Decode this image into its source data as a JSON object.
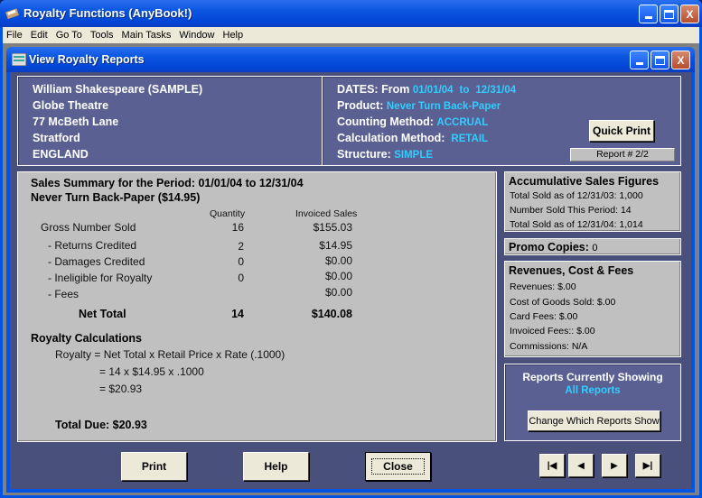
{
  "app": {
    "title": "Royalty Functions (AnyBook!)",
    "controls": {
      "minimize": "_",
      "maximize": "□",
      "close": "X"
    }
  },
  "menu": [
    "File",
    "Edit",
    "Go To",
    "Tools",
    "Main Tasks",
    "Window",
    "Help"
  ],
  "window": {
    "title": "View Royalty Reports"
  },
  "author": {
    "lines": [
      "William Shakespeare (SAMPLE)",
      "Globe Theatre",
      "77 McBeth Lane",
      "Stratford",
      "ENGLAND"
    ]
  },
  "info": {
    "dates_label": "DATES:  From",
    "date_from": "01/01/04",
    "to_label": "to",
    "date_to": "12/31/04",
    "product_label": "Product:",
    "product": "Never Turn Back-Paper",
    "counting_label": "Counting Method:",
    "counting": "ACCRUAL",
    "calc_label": "Calculation Method:",
    "calc": "RETAIL",
    "structure_label": "Structure:",
    "structure": "SIMPLE",
    "quick_print": "Quick Print",
    "report_num": "Report # 2/2"
  },
  "summary": {
    "title": "Sales Summary for the Period:  01/01/04 to 12/31/04",
    "product": "Never Turn Back-Paper ($14.95)",
    "col_qty": "Quantity",
    "col_sales": "Invoiced Sales",
    "rows": [
      {
        "label": "Gross Number Sold",
        "qty": "16",
        "sales": "$155.03"
      },
      {
        "label": "- Returns Credited",
        "qty": "2",
        "sales": "$14.95"
      },
      {
        "label": "- Damages Credited",
        "qty": "0",
        "sales": "$0.00"
      },
      {
        "label": "- Ineligible for Royalty",
        "qty": "0",
        "sales": "$0.00"
      },
      {
        "label": "- Fees",
        "qty": "",
        "sales": "$0.00"
      }
    ],
    "net": {
      "label": "Net Total",
      "qty": "14",
      "sales": "$140.08"
    },
    "royalty_title": "Royalty Calculations",
    "formula1": "Royalty  =  Net Total  x  Retail Price  x  Rate (.1000)",
    "formula2": "=  14 x $14.95 x .1000",
    "formula3": "=  $20.93",
    "total_due": "Total Due: $20.93"
  },
  "accum": {
    "title": "Accumulative Sales Figures",
    "items": [
      "Total Sold as of 12/31/03: 1,000",
      "Number Sold This Period: 14",
      "Total Sold as of 12/31/04: 1,014"
    ]
  },
  "promo": {
    "label": "Promo Copies:",
    "value": "0"
  },
  "revenues": {
    "title": "Revenues, Cost & Fees",
    "items": [
      "Revenues: $.00",
      "Cost of Goods Sold: $.00",
      "Card Fees: $.00",
      "Invoiced Fees:: $.00",
      "Commissions: N/A"
    ]
  },
  "reports": {
    "title": "Reports Currently Showing",
    "value": "All Reports",
    "button": "Change Which Reports Show"
  },
  "buttons": {
    "print": "Print",
    "help": "Help",
    "close": "Close"
  },
  "nav": {
    "first": "⏮",
    "prev": "◀",
    "next": "▶",
    "last": "⏭"
  }
}
